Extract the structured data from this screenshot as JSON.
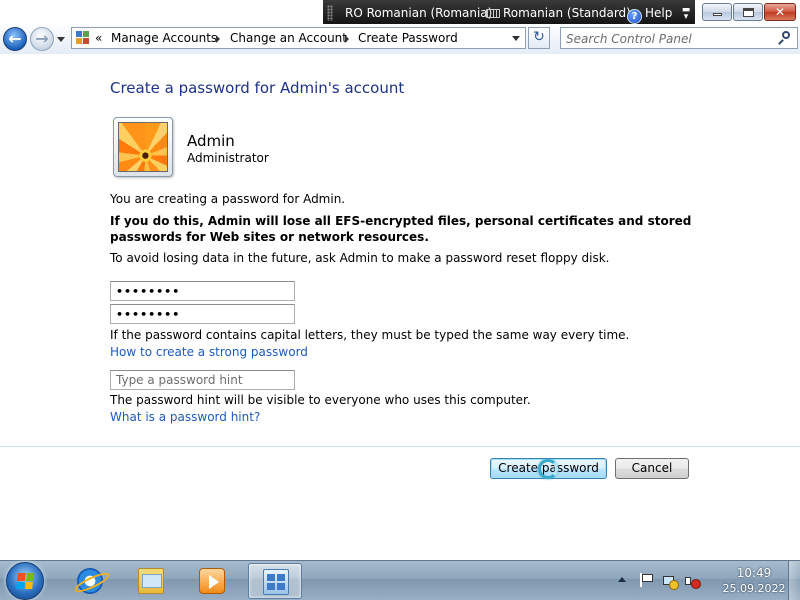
{
  "window": {
    "title": "Create Password"
  },
  "language_bar": {
    "language": "RO Romanian (Romania)",
    "keyboard": "Romanian (Standard)",
    "help": "Help"
  },
  "navigation": {
    "breadcrumb_prefix": "«",
    "breadcrumbs": [
      "Manage Accounts",
      "Change an Account",
      "Create Password"
    ],
    "search_placeholder": "Search Control Panel"
  },
  "main": {
    "title": "Create a password for Admin's account",
    "user": {
      "name": "Admin",
      "role": "Administrator"
    },
    "info_text": "You are creating a password for Admin.",
    "warning_text": "If you do this, Admin will lose all EFS-encrypted files, personal certificates and stored passwords for Web sites or network resources.",
    "reset_disk_text": "To avoid losing data in the future, ask Admin to make a password reset floppy disk.",
    "new_password_value": "••••••••",
    "confirm_password_value": "••••••••",
    "case_note": "If the password contains capital letters, they must be typed the same way every time.",
    "strong_password_link": "How to create a strong password",
    "hint_placeholder": "Type a password hint",
    "hint_note": "The password hint will be visible to everyone who uses this computer.",
    "hint_link": "What is a password hint?",
    "create_button": "Create password",
    "cancel_button": "Cancel"
  },
  "taskbar": {
    "apps": [
      "Internet Explorer",
      "Windows Explorer",
      "Windows Media Player",
      "Control Panel"
    ],
    "active_app": "Control Panel",
    "clock_time": "10:49",
    "clock_date": "25.09.2022"
  },
  "colors": {
    "title": "#1e3287",
    "link": "#1f5bbf",
    "taskbar": "#8fa7bd",
    "close_button": "#c03a22"
  }
}
